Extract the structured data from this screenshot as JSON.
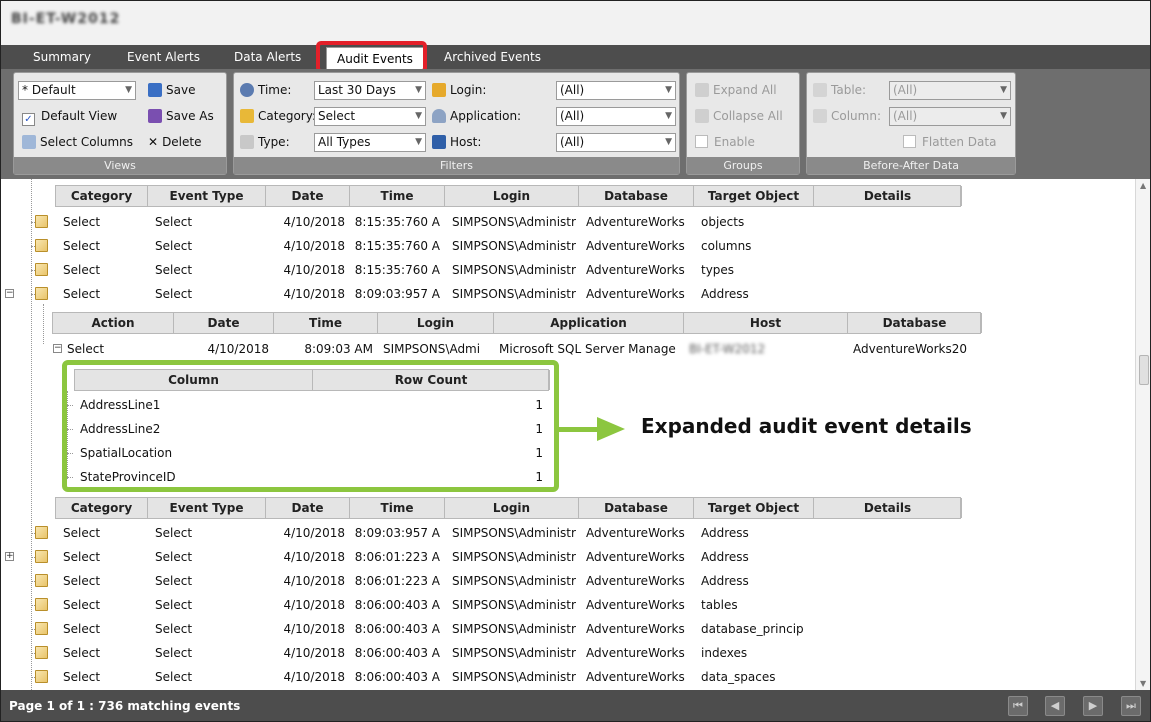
{
  "window": {
    "title": "BI-ET-W2012"
  },
  "tabs": [
    {
      "label": "Summary"
    },
    {
      "label": "Event Alerts"
    },
    {
      "label": "Data Alerts"
    },
    {
      "label": "Audit Events"
    },
    {
      "label": "Archived Events"
    }
  ],
  "ribbon": {
    "views": {
      "label": "Views",
      "view_select": "* Default",
      "save": "Save",
      "save_as": "Save As",
      "default_view": "Default View",
      "select_columns": "Select Columns",
      "delete": "Delete"
    },
    "filters": {
      "label": "Filters",
      "time_label": "Time:",
      "time_value": "Last 30 Days",
      "category_label": "Category:",
      "category_value": "Select",
      "type_label": "Type:",
      "type_value": "All Types",
      "login_label": "Login:",
      "login_value": "(All)",
      "application_label": "Application:",
      "application_value": "(All)",
      "host_label": "Host:",
      "host_value": "(All)"
    },
    "groups": {
      "label": "Groups",
      "expand_all": "Expand All",
      "collapse_all": "Collapse All",
      "enable": "Enable"
    },
    "before_after": {
      "label": "Before-After Data",
      "table_label": "Table:",
      "table_value": "(All)",
      "column_label": "Column:",
      "column_value": "(All)",
      "flatten": "Flatten Data"
    }
  },
  "events_table": {
    "columns": [
      "Category",
      "Event Type",
      "Date",
      "Time",
      "Login",
      "Database",
      "Target Object",
      "Details"
    ],
    "rows_top": [
      [
        "Select",
        "Select",
        "4/10/2018",
        "8:15:35:760 A",
        "SIMPSONS\\Administr",
        "AdventureWorks",
        "objects",
        ""
      ],
      [
        "Select",
        "Select",
        "4/10/2018",
        "8:15:35:760 A",
        "SIMPSONS\\Administr",
        "AdventureWorks",
        "columns",
        ""
      ],
      [
        "Select",
        "Select",
        "4/10/2018",
        "8:15:35:760 A",
        "SIMPSONS\\Administr",
        "AdventureWorks",
        "types",
        ""
      ],
      [
        "Select",
        "Select",
        "4/10/2018",
        "8:09:03:957 A",
        "SIMPSONS\\Administr",
        "AdventureWorks",
        "Address",
        ""
      ]
    ],
    "rows_bottom": [
      [
        "Select",
        "Select",
        "4/10/2018",
        "8:09:03:957 A",
        "SIMPSONS\\Administr",
        "AdventureWorks",
        "Address",
        ""
      ],
      [
        "Select",
        "Select",
        "4/10/2018",
        "8:06:01:223 A",
        "SIMPSONS\\Administr",
        "AdventureWorks",
        "Address",
        ""
      ],
      [
        "Select",
        "Select",
        "4/10/2018",
        "8:06:01:223 A",
        "SIMPSONS\\Administr",
        "AdventureWorks",
        "Address",
        ""
      ],
      [
        "Select",
        "Select",
        "4/10/2018",
        "8:06:00:403 A",
        "SIMPSONS\\Administr",
        "AdventureWorks",
        "tables",
        ""
      ],
      [
        "Select",
        "Select",
        "4/10/2018",
        "8:06:00:403 A",
        "SIMPSONS\\Administr",
        "AdventureWorks",
        "database_princip",
        ""
      ],
      [
        "Select",
        "Select",
        "4/10/2018",
        "8:06:00:403 A",
        "SIMPSONS\\Administr",
        "AdventureWorks",
        "indexes",
        ""
      ],
      [
        "Select",
        "Select",
        "4/10/2018",
        "8:06:00:403 A",
        "SIMPSONS\\Administr",
        "AdventureWorks",
        "data_spaces",
        ""
      ]
    ]
  },
  "detail_table": {
    "columns": [
      "Action",
      "Date",
      "Time",
      "Login",
      "Application",
      "Host",
      "Database"
    ],
    "row": [
      "Select",
      "4/10/2018",
      "8:09:03 AM",
      "SIMPSONS\\Admi",
      "Microsoft SQL Server Manage",
      "BI-ET-W2012",
      "AdventureWorks20"
    ]
  },
  "column_table": {
    "columns": [
      "Column",
      "Row Count"
    ],
    "rows": [
      [
        "AddressLine1",
        "1"
      ],
      [
        "AddressLine2",
        "1"
      ],
      [
        "SpatialLocation",
        "1"
      ],
      [
        "StateProvinceID",
        "1"
      ]
    ]
  },
  "annotation": "Expanded audit event details",
  "status": {
    "text": "Page 1 of 1 : 736 matching events"
  },
  "colors": {
    "highlight_red": "#e3202a",
    "highlight_green": "#8cc63f",
    "tabbar": "#4d4d4d"
  }
}
